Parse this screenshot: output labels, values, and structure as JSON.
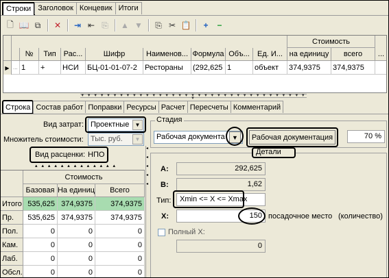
{
  "tabs": [
    "Строки",
    "Заголовок",
    "Концевик",
    "Итоги"
  ],
  "grid": {
    "group_header": "Стоимость",
    "headers": [
      "№",
      "Тип",
      "Рас...",
      "Шифр",
      "Наименов...",
      "Формула",
      "Объ...",
      "Ед. И...",
      "на единицу",
      "всего",
      "..."
    ],
    "row": [
      "1",
      "+",
      "НСИ",
      "БЦ-01-01-07-2",
      "Рестораны",
      "(292,625",
      "1",
      "объект",
      "374,9375",
      "374,9375",
      ""
    ],
    "row_prefix": "..."
  },
  "subtabs": [
    "Строка",
    "Состав работ",
    "Поправки",
    "Ресурсы",
    "Расчет",
    "Пересчеты",
    "Комментарий"
  ],
  "form": {
    "vid_zatrat_label": "Вид затрат:",
    "vid_zatrat_value": "Проектные",
    "mnozh_label": "Множитель стоимости:",
    "mnozh_value": "Тыс. руб.",
    "vid_rascenki_label": "Вид расценки:",
    "vid_rascenki_value": "НПО"
  },
  "cost_table": {
    "title": "Стоимость",
    "headers": [
      "Базовая",
      "На единиц",
      "Всего"
    ],
    "rows": [
      {
        "label": "Итого",
        "values": [
          "535,625",
          "374,9375",
          "374,9375"
        ]
      },
      {
        "label": "Пр.",
        "values": [
          "535,625",
          "374,9375",
          "374,9375"
        ]
      },
      {
        "label": "Пол.",
        "values": [
          "0",
          "0",
          "0"
        ]
      },
      {
        "label": "Кам.",
        "values": [
          "0",
          "0",
          "0"
        ]
      },
      {
        "label": "Лаб.",
        "values": [
          "0",
          "0",
          "0"
        ]
      },
      {
        "label": "Обсл.",
        "values": [
          "0",
          "0",
          "0"
        ]
      }
    ]
  },
  "stadiya": {
    "title": "Стадия",
    "combo_value": "Рабочая документа",
    "button_label": "Рабочая документация",
    "percent_value": "70 %"
  },
  "details": {
    "title": "Детали",
    "a_label": "A:",
    "a_value": "292,625",
    "b_label": "B:",
    "b_value": "1,62",
    "type_label": "Тип:",
    "type_value": "Xmin <= X <= Xmax",
    "x_label": "X:",
    "x_value": "150",
    "x_unit": "посадочное место",
    "x_measure": "(количество)",
    "full_x_label": "Полный X:",
    "full_x_value": "0"
  },
  "colors": {
    "highlight_row": "#a8dcb0",
    "selected_row": "#c6e2ff"
  }
}
